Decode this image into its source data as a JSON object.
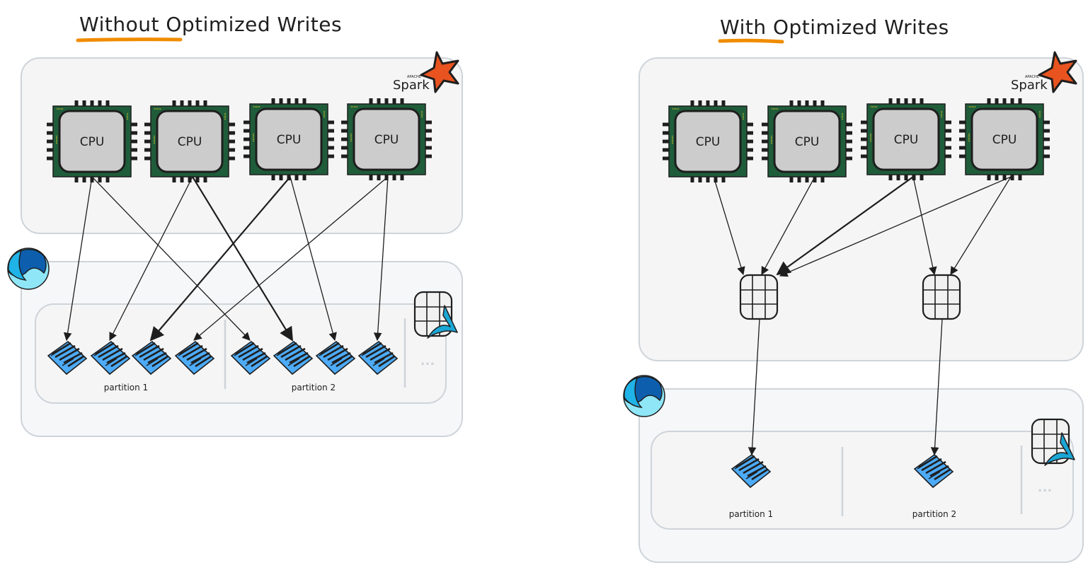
{
  "colors": {
    "panel_fill": "#f5f5f5",
    "lake_fill": "#f6f7f9",
    "panel_border": "#ced4da",
    "underline": "#f08c00",
    "chip_green": "#1f5c3a",
    "chip_core": "#cccccc",
    "arrow": "#1e1e1e",
    "parquet_blue": "#4dabf7",
    "spark_orange": "#e8531f",
    "delta_blue": "#1aa7d6",
    "fabric_dark": "#0d5fae",
    "fabric_mid": "#1fb3e8",
    "fabric_light": "#8fe6f7"
  },
  "diagrams": [
    {
      "id": "without",
      "title_emphasis": "Without",
      "title_rest": " Optimized Writes",
      "spark_label": "Spark",
      "spark_super": "APACHE",
      "cpus": [
        "CPU",
        "CPU",
        "CPU",
        "CPU"
      ],
      "partitions": [
        {
          "label": "partition 1",
          "files": 4
        },
        {
          "label": "partition 2",
          "files": 4
        }
      ],
      "more_label": "...",
      "writes": [
        {
          "cpu": 0,
          "partition": 0,
          "file": 0
        },
        {
          "cpu": 0,
          "partition": 1,
          "file": 0
        },
        {
          "cpu": 1,
          "partition": 0,
          "file": 1
        },
        {
          "cpu": 1,
          "partition": 1,
          "file": 1
        },
        {
          "cpu": 2,
          "partition": 0,
          "file": 2
        },
        {
          "cpu": 2,
          "partition": 1,
          "file": 2
        },
        {
          "cpu": 3,
          "partition": 0,
          "file": 3
        },
        {
          "cpu": 3,
          "partition": 1,
          "file": 3
        }
      ]
    },
    {
      "id": "with",
      "title_emphasis": "With",
      "title_rest": " Optimized Writes",
      "spark_label": "Spark",
      "spark_super": "APACHE",
      "cpus": [
        "CPU",
        "CPU",
        "CPU",
        "CPU"
      ],
      "buffers": 2,
      "partitions": [
        {
          "label": "partition 1",
          "files": 1
        },
        {
          "label": "partition 2",
          "files": 1
        }
      ],
      "more_label": "...",
      "shuffles": [
        {
          "cpu": 0,
          "buffer": 0
        },
        {
          "cpu": 1,
          "buffer": 0
        },
        {
          "cpu": 2,
          "buffer": 0
        },
        {
          "cpu": 2,
          "buffer": 1
        },
        {
          "cpu": 3,
          "buffer": 0
        },
        {
          "cpu": 3,
          "buffer": 1
        }
      ],
      "writes": [
        {
          "buffer": 0,
          "partition": 0
        },
        {
          "buffer": 1,
          "partition": 1
        }
      ]
    }
  ]
}
